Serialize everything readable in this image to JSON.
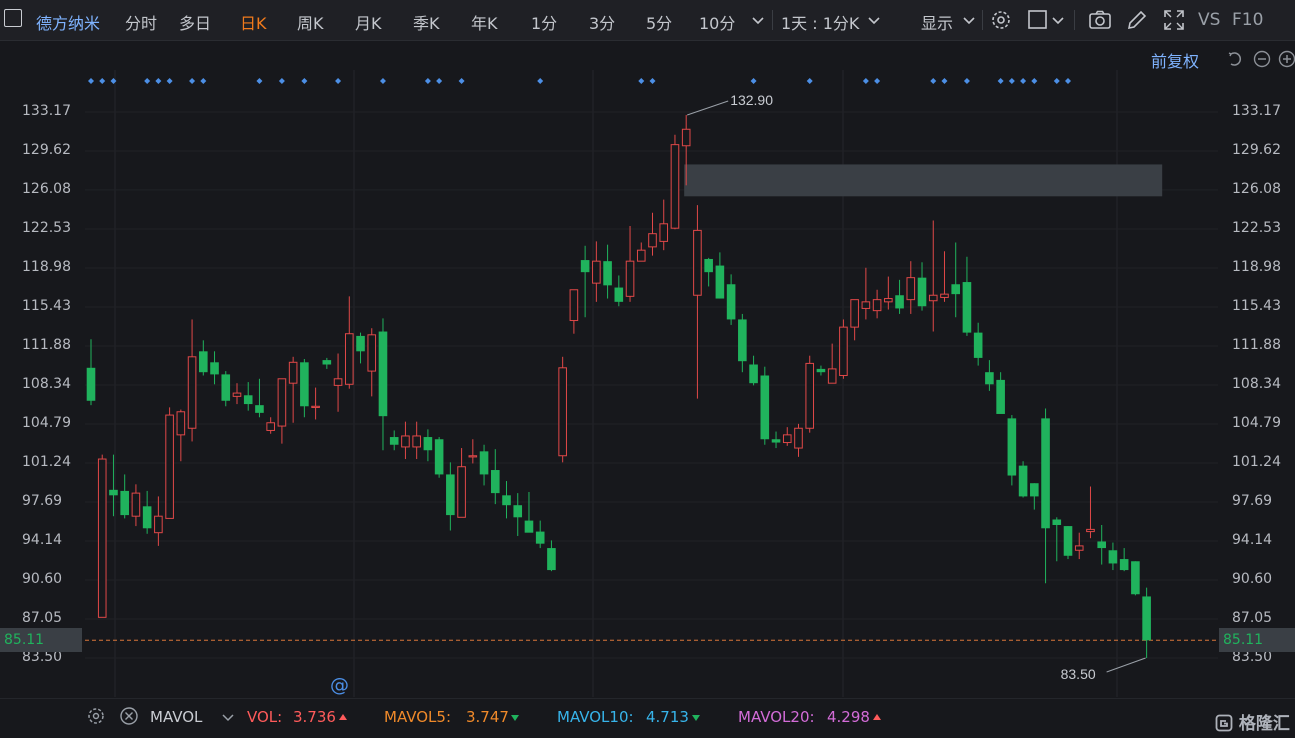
{
  "toolbar": {
    "stock_name": "德方纳米",
    "tabs": [
      "分时",
      "多日",
      "日K",
      "周K",
      "月K",
      "季K",
      "年K",
      "1分",
      "3分",
      "5分",
      "10分"
    ],
    "active_tab": "日K",
    "period_select": "1天 : 1分K",
    "display_label": "显示",
    "vs_label": "VS",
    "f10_label": "F10"
  },
  "chart_header": {
    "adjust_label": "前复权"
  },
  "y_axis": {
    "ticks": [
      "133.17",
      "129.62",
      "126.08",
      "122.53",
      "118.98",
      "115.43",
      "111.88",
      "108.34",
      "104.79",
      "101.24",
      "97.69",
      "94.14",
      "90.60",
      "87.05",
      "83.50"
    ],
    "current_price": "85.11"
  },
  "annotations": {
    "high_label": "132.90",
    "low_label": "83.50",
    "marker_symbol": "@"
  },
  "volume_bar": {
    "indicator_label": "MAVOL",
    "vol_label": "VOL:",
    "vol_value": "3.736",
    "mavol5_label": "MAVOL5:",
    "mavol5_value": "3.747",
    "mavol10_label": "MAVOL10:",
    "mavol10_value": "4.713",
    "mavol20_label": "MAVOL20:",
    "mavol20_value": "4.298"
  },
  "watermark": "格隆汇",
  "colors": {
    "up": "#e04848",
    "down": "#20b35d",
    "active_tab": "#f07a1c",
    "accent": "#7fb3ff",
    "vol": "#ff5b5b",
    "mavol5": "#f08a2a",
    "mavol10": "#37b4ea",
    "mavol20": "#d36cd8"
  },
  "chart_data": {
    "type": "candlestick",
    "ylim": [
      83.5,
      133.17
    ],
    "current_price": 85.11,
    "candles": [
      {
        "o": 109.9,
        "h": 112.5,
        "l": 106.5,
        "c": 106.9
      },
      {
        "o": 87.2,
        "h": 102.0,
        "l": 87.2,
        "c": 101.6
      },
      {
        "o": 98.8,
        "h": 102.0,
        "l": 96.4,
        "c": 98.3
      },
      {
        "o": 98.7,
        "h": 100.2,
        "l": 96.2,
        "c": 96.5
      },
      {
        "o": 96.4,
        "h": 99.3,
        "l": 95.5,
        "c": 98.5
      },
      {
        "o": 97.3,
        "h": 98.7,
        "l": 94.8,
        "c": 95.3
      },
      {
        "o": 94.9,
        "h": 98.2,
        "l": 93.7,
        "c": 96.4
      },
      {
        "o": 96.2,
        "h": 106.3,
        "l": 96.2,
        "c": 105.6
      },
      {
        "o": 103.8,
        "h": 106.1,
        "l": 101.4,
        "c": 105.9
      },
      {
        "o": 104.4,
        "h": 114.3,
        "l": 103.2,
        "c": 110.9
      },
      {
        "o": 111.4,
        "h": 112.4,
        "l": 109.2,
        "c": 109.5
      },
      {
        "o": 110.4,
        "h": 111.4,
        "l": 108.4,
        "c": 109.3
      },
      {
        "o": 109.3,
        "h": 109.6,
        "l": 106.4,
        "c": 106.9
      },
      {
        "o": 107.3,
        "h": 108.5,
        "l": 106.6,
        "c": 107.6
      },
      {
        "o": 107.4,
        "h": 108.6,
        "l": 106.0,
        "c": 106.6
      },
      {
        "o": 106.5,
        "h": 108.9,
        "l": 105.4,
        "c": 105.8
      },
      {
        "o": 104.2,
        "h": 105.4,
        "l": 103.9,
        "c": 104.9
      },
      {
        "o": 104.6,
        "h": 108.9,
        "l": 103.0,
        "c": 108.9
      },
      {
        "o": 108.5,
        "h": 110.9,
        "l": 104.9,
        "c": 110.4
      },
      {
        "o": 110.4,
        "h": 110.7,
        "l": 105.4,
        "c": 106.4
      },
      {
        "o": 106.3,
        "h": 108.1,
        "l": 105.2,
        "c": 106.4
      },
      {
        "o": 110.6,
        "h": 110.8,
        "l": 109.8,
        "c": 110.2
      },
      {
        "o": 108.3,
        "h": 111.2,
        "l": 105.9,
        "c": 108.9
      },
      {
        "o": 108.4,
        "h": 116.4,
        "l": 108.0,
        "c": 113.0
      },
      {
        "o": 112.8,
        "h": 113.1,
        "l": 110.3,
        "c": 111.4
      },
      {
        "o": 109.6,
        "h": 113.5,
        "l": 107.3,
        "c": 112.9
      },
      {
        "o": 113.2,
        "h": 114.4,
        "l": 102.4,
        "c": 105.5
      },
      {
        "o": 103.6,
        "h": 104.2,
        "l": 102.4,
        "c": 102.9
      },
      {
        "o": 102.7,
        "h": 105.0,
        "l": 101.6,
        "c": 103.7
      },
      {
        "o": 102.7,
        "h": 105.0,
        "l": 101.6,
        "c": 103.7
      },
      {
        "o": 103.6,
        "h": 104.3,
        "l": 101.4,
        "c": 102.4
      },
      {
        "o": 103.4,
        "h": 103.6,
        "l": 99.9,
        "c": 100.2
      },
      {
        "o": 100.2,
        "h": 101.3,
        "l": 95.1,
        "c": 96.5
      },
      {
        "o": 96.3,
        "h": 102.6,
        "l": 96.3,
        "c": 100.9
      },
      {
        "o": 101.9,
        "h": 103.4,
        "l": 101.2,
        "c": 101.9
      },
      {
        "o": 102.3,
        "h": 102.9,
        "l": 99.2,
        "c": 100.2
      },
      {
        "o": 100.6,
        "h": 102.5,
        "l": 97.5,
        "c": 98.5
      },
      {
        "o": 98.3,
        "h": 99.6,
        "l": 96.2,
        "c": 97.4
      },
      {
        "o": 97.4,
        "h": 98.5,
        "l": 94.6,
        "c": 96.3
      },
      {
        "o": 96.0,
        "h": 98.6,
        "l": 95.0,
        "c": 94.9
      },
      {
        "o": 95.0,
        "h": 96.0,
        "l": 93.5,
        "c": 93.9
      },
      {
        "o": 93.5,
        "h": 94.2,
        "l": 91.4,
        "c": 91.5
      },
      {
        "o": 101.9,
        "h": 110.9,
        "l": 101.3,
        "c": 109.9
      },
      {
        "o": 114.2,
        "h": 117.0,
        "l": 113.0,
        "c": 117.0
      },
      {
        "o": 119.7,
        "h": 121.0,
        "l": 114.5,
        "c": 118.6
      },
      {
        "o": 117.6,
        "h": 121.4,
        "l": 115.9,
        "c": 119.6
      },
      {
        "o": 119.6,
        "h": 121.1,
        "l": 116.2,
        "c": 117.4
      },
      {
        "o": 117.2,
        "h": 118.3,
        "l": 115.5,
        "c": 115.9
      },
      {
        "o": 116.4,
        "h": 122.8,
        "l": 115.9,
        "c": 119.6
      },
      {
        "o": 119.6,
        "h": 121.3,
        "l": 119.6,
        "c": 120.6
      },
      {
        "o": 120.9,
        "h": 124.0,
        "l": 120.1,
        "c": 122.1
      },
      {
        "o": 121.4,
        "h": 125.2,
        "l": 120.6,
        "c": 123.0
      },
      {
        "o": 122.6,
        "h": 131.1,
        "l": 122.5,
        "c": 130.2
      },
      {
        "o": 130.1,
        "h": 132.9,
        "l": 126.5,
        "c": 131.6
      },
      {
        "o": 116.5,
        "h": 124.7,
        "l": 107.1,
        "c": 122.4
      },
      {
        "o": 119.8,
        "h": 119.9,
        "l": 117.3,
        "c": 118.6
      },
      {
        "o": 119.2,
        "h": 120.4,
        "l": 116.2,
        "c": 116.2
      },
      {
        "o": 117.5,
        "h": 118.4,
        "l": 113.8,
        "c": 114.3
      },
      {
        "o": 114.3,
        "h": 114.8,
        "l": 109.5,
        "c": 110.5
      },
      {
        "o": 110.2,
        "h": 111.0,
        "l": 108.3,
        "c": 108.5
      },
      {
        "o": 109.2,
        "h": 110.0,
        "l": 102.9,
        "c": 103.4
      },
      {
        "o": 103.4,
        "h": 104.1,
        "l": 102.6,
        "c": 103.1
      },
      {
        "o": 103.1,
        "h": 104.5,
        "l": 102.8,
        "c": 103.8
      },
      {
        "o": 102.6,
        "h": 104.8,
        "l": 101.8,
        "c": 104.4
      },
      {
        "o": 104.4,
        "h": 111.0,
        "l": 104.0,
        "c": 110.3
      },
      {
        "o": 109.8,
        "h": 110.1,
        "l": 109.2,
        "c": 109.5
      },
      {
        "o": 108.5,
        "h": 112.1,
        "l": 108.5,
        "c": 109.8
      },
      {
        "o": 109.2,
        "h": 114.3,
        "l": 108.9,
        "c": 113.6
      },
      {
        "o": 113.6,
        "h": 116.1,
        "l": 112.4,
        "c": 116.1
      },
      {
        "o": 115.3,
        "h": 119.0,
        "l": 114.3,
        "c": 115.9
      },
      {
        "o": 115.1,
        "h": 117.0,
        "l": 114.4,
        "c": 116.1
      },
      {
        "o": 115.9,
        "h": 118.2,
        "l": 115.2,
        "c": 116.2
      },
      {
        "o": 116.5,
        "h": 117.9,
        "l": 114.8,
        "c": 115.3
      },
      {
        "o": 116.1,
        "h": 119.6,
        "l": 114.8,
        "c": 118.1
      },
      {
        "o": 118.1,
        "h": 119.5,
        "l": 115.1,
        "c": 115.5
      },
      {
        "o": 116.0,
        "h": 123.3,
        "l": 113.2,
        "c": 116.5
      },
      {
        "o": 116.3,
        "h": 120.5,
        "l": 115.9,
        "c": 116.6
      },
      {
        "o": 117.5,
        "h": 121.3,
        "l": 114.5,
        "c": 116.6
      },
      {
        "o": 117.7,
        "h": 120.0,
        "l": 112.8,
        "c": 113.1
      },
      {
        "o": 113.1,
        "h": 114.0,
        "l": 110.1,
        "c": 110.8
      },
      {
        "o": 109.5,
        "h": 110.6,
        "l": 107.8,
        "c": 108.4
      },
      {
        "o": 108.8,
        "h": 109.5,
        "l": 105.9,
        "c": 105.7
      },
      {
        "o": 105.3,
        "h": 105.6,
        "l": 99.2,
        "c": 100.1
      },
      {
        "o": 101.0,
        "h": 101.4,
        "l": 98.1,
        "c": 98.2
      },
      {
        "o": 99.4,
        "h": 99.4,
        "l": 97.0,
        "c": 98.2
      },
      {
        "o": 105.3,
        "h": 106.2,
        "l": 90.3,
        "c": 95.3
      },
      {
        "o": 96.1,
        "h": 96.3,
        "l": 92.3,
        "c": 95.6
      },
      {
        "o": 95.5,
        "h": 95.5,
        "l": 92.5,
        "c": 92.8
      },
      {
        "o": 93.3,
        "h": 94.9,
        "l": 92.5,
        "c": 93.7
      },
      {
        "o": 95.0,
        "h": 99.1,
        "l": 94.4,
        "c": 95.2
      },
      {
        "o": 94.1,
        "h": 95.6,
        "l": 92.0,
        "c": 93.5
      },
      {
        "o": 93.3,
        "h": 94.0,
        "l": 91.5,
        "c": 92.1
      },
      {
        "o": 92.5,
        "h": 93.5,
        "l": 91.4,
        "c": 91.5
      },
      {
        "o": 92.3,
        "h": 92.3,
        "l": 89.2,
        "c": 89.3
      },
      {
        "o": 89.1,
        "h": 89.9,
        "l": 83.5,
        "c": 85.11
      }
    ],
    "event_marker_columns": [
      0,
      1,
      2,
      5,
      6,
      7,
      9,
      10,
      15,
      17,
      19,
      22,
      26,
      30,
      31,
      33,
      40,
      49,
      50,
      59,
      64,
      69,
      70,
      75,
      76,
      78,
      81,
      82,
      83,
      84,
      86,
      87
    ],
    "resistance_zone": {
      "y_top": 128.4,
      "y_bottom": 125.5,
      "from_candle": 53
    },
    "high": 132.9,
    "low": 83.5
  }
}
